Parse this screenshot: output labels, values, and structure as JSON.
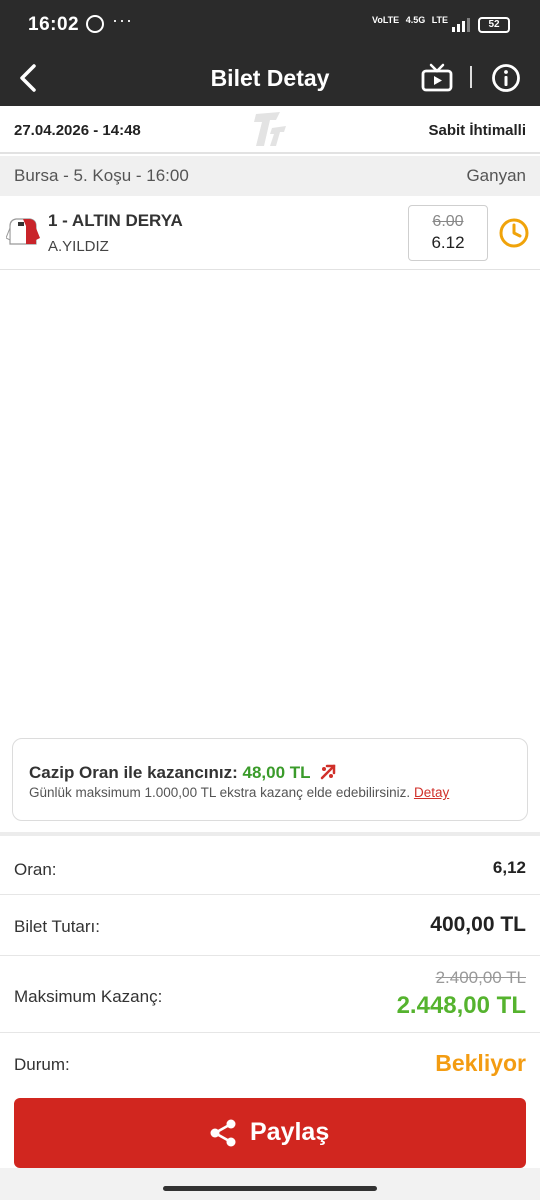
{
  "status_bar": {
    "time": "16:02",
    "network_labels": [
      "VoLTE",
      "4.5G",
      "LTE"
    ],
    "battery": "52",
    "signal_level": 0.8
  },
  "app_bar": {
    "title": "Bilet Detay",
    "back_icon": "chevron-left-icon",
    "tv_icon": "tv-icon",
    "info_icon": "info-icon"
  },
  "ticket": {
    "date": "27.04.2026 - 14:48",
    "bet_mode": "Sabit İhtimalli"
  },
  "race": {
    "title": "Bursa - 5. Koşu - 16:00",
    "bet_type": "Ganyan"
  },
  "selection": {
    "horse": "1 - ALTIN DERYA",
    "jockey": "A.YILDIZ",
    "old_odds": "6.00",
    "new_odds": "6.12",
    "status_icon": "clock-icon"
  },
  "promo": {
    "label": "Cazip Oran ile kazancınız:",
    "amount": "48,00 TL",
    "note": "Günlük maksimum 1.000,00 TL ekstra kazanç elde edebilirsiniz.",
    "link": "Detay"
  },
  "summary": {
    "odds_label": "Oran:",
    "odds_value": "6,12",
    "stake_label": "Bilet Tutarı:",
    "stake_value": "400,00 TL",
    "max_win_label": "Maksimum Kazanç:",
    "max_win_old": "2.400,00 TL",
    "max_win_new": "2.448,00 TL",
    "status_label": "Durum:",
    "status_value": "Bekliyor"
  },
  "share_button": {
    "label": "Paylaş",
    "icon": "share-icon"
  },
  "colors": {
    "header_bg": "#2b2b2b",
    "accent_red": "#d1261f",
    "win_green": "#55b32e",
    "pending_orange": "#f39c12",
    "clock_orange": "#f0a30a"
  }
}
